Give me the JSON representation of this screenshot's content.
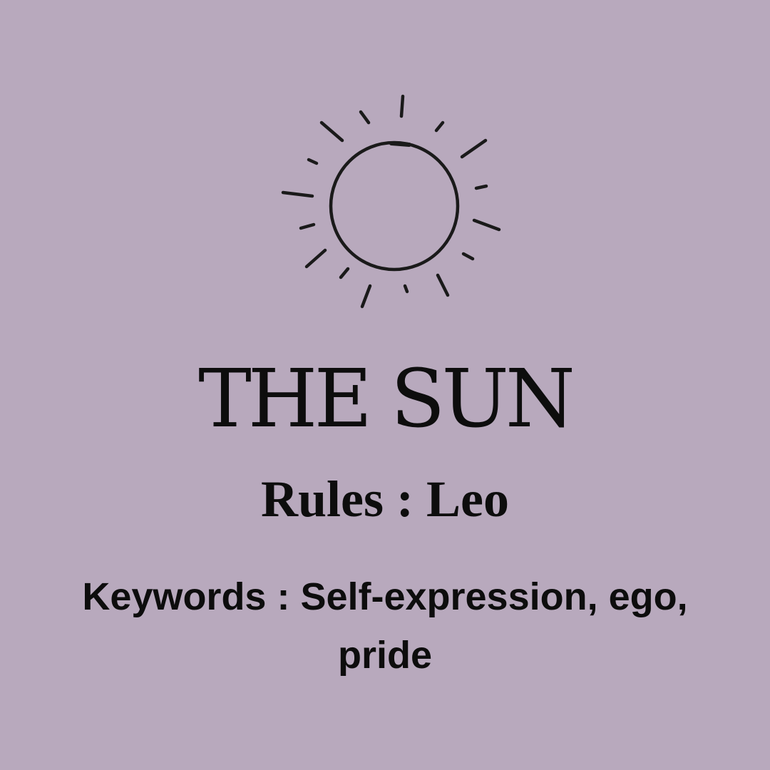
{
  "card": {
    "background_color": "#b8a9bd",
    "text_color": "#0d0d0d",
    "icon": "sun-icon",
    "title": "THE SUN",
    "rules": "Rules : Leo",
    "keywords": "Keywords : Self-expression, ego, pride"
  }
}
